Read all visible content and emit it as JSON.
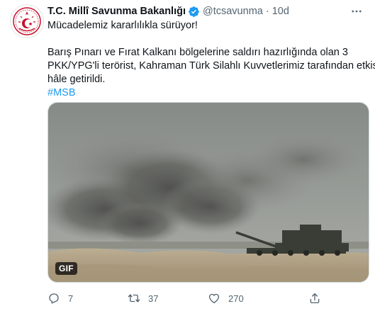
{
  "tweet": {
    "display_name": "T.C. Millî Savunma Bakanlığı",
    "handle": "@tcsavunma",
    "separator": "·",
    "time": "10d",
    "text_lines": [
      "Mücadelemiz kararlılıkla sürüyor!",
      "Barış Pınarı ve Fırat Kalkanı bölgelerine saldırı hazırlığında olan 3",
      "PKK/YPG'li terörist, Kahraman Türk Silahlı Kuvvetlerimiz tarafından etkisiz",
      "hâle getirildi."
    ],
    "hashtag": "#MSB",
    "media": {
      "badge": "GIF"
    },
    "actions": {
      "replies": "7",
      "retweets": "37",
      "likes": "270"
    }
  },
  "colors": {
    "accent": "#1d9bf0",
    "text_primary": "#0f1419",
    "text_secondary": "#536471",
    "logo_red": "#c8102e"
  },
  "icons": {
    "verified": "verified-badge-icon",
    "more": "more-icon",
    "reply": "reply-icon",
    "retweet": "retweet-icon",
    "like": "heart-icon",
    "share": "share-icon"
  }
}
